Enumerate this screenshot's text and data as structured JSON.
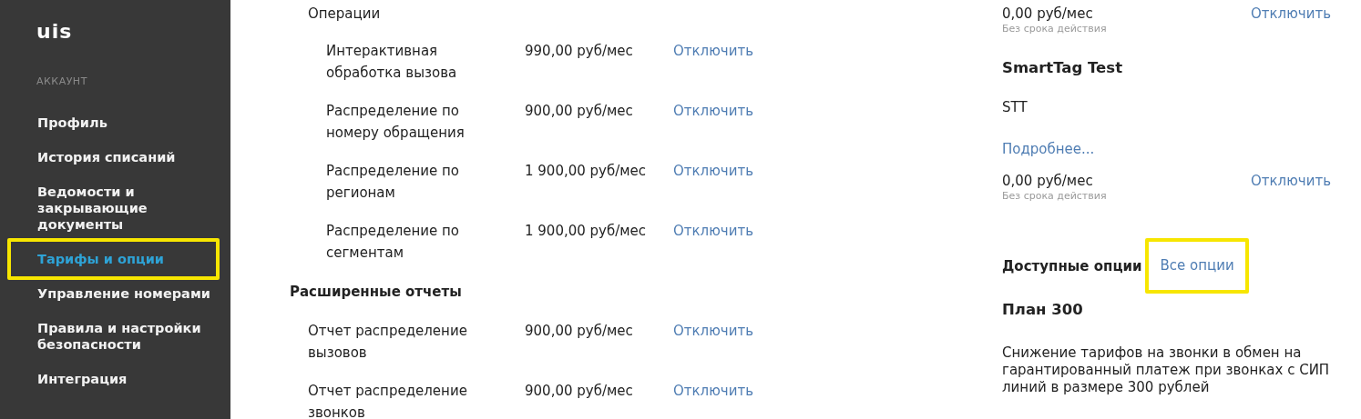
{
  "sidebar": {
    "logo": "uis",
    "section": "АККАУНТ",
    "items": [
      {
        "label": "Профиль",
        "selected": false,
        "highlighted": false
      },
      {
        "label": "История списаний",
        "selected": false,
        "highlighted": false
      },
      {
        "label": "Ведомости и закрывающие документы",
        "selected": false,
        "highlighted": false
      },
      {
        "label": "Тарифы и опции",
        "selected": true,
        "highlighted": true
      },
      {
        "label": "Управление номерами",
        "selected": false,
        "highlighted": false
      },
      {
        "label": "Правила и настройки безопасности",
        "selected": false,
        "highlighted": false
      },
      {
        "label": "Интеграция",
        "selected": false,
        "highlighted": false
      }
    ]
  },
  "services": {
    "groups": [
      {
        "title": "Операции",
        "kind": "subgroup",
        "items": [
          {
            "name": "Интерактивная обработка вызова",
            "price": "990,00 руб/мес",
            "action": "Отключить"
          },
          {
            "name": "Распределение по номеру обращения",
            "price": "900,00 руб/мес",
            "action": "Отключить"
          },
          {
            "name": "Распределение по регионам",
            "price": "1 900,00 руб/мес",
            "action": "Отключить"
          },
          {
            "name": "Распределение по сегментам",
            "price": "1 900,00 руб/мес",
            "action": "Отключить"
          }
        ]
      },
      {
        "title": "Расширенные отчеты",
        "kind": "group",
        "items": [
          {
            "name": "Отчет распределение вызовов",
            "price": "900,00 руб/мес",
            "action": "Отключить"
          },
          {
            "name": "Отчет распределение звонков",
            "price": "900,00 руб/мес",
            "action": "Отключить"
          }
        ]
      }
    ]
  },
  "connected": [
    {
      "price": "0,00 руб/мес",
      "term": "Без срока действия",
      "action": "Отключить"
    },
    {
      "title": "SmartTag Test",
      "code": "STT",
      "more": "Подробнее...",
      "price": "0,00 руб/мес",
      "term": "Без срока действия",
      "action": "Отключить"
    }
  ],
  "available": {
    "title": "Доступные опции",
    "link": {
      "label": "Все опции",
      "highlighted": true
    },
    "plans": [
      {
        "title": "План 300",
        "description": "Снижение тарифов на звонки в обмен на гарантированный платеж при звонках с СИП линий в размере 300 рублей"
      }
    ]
  }
}
